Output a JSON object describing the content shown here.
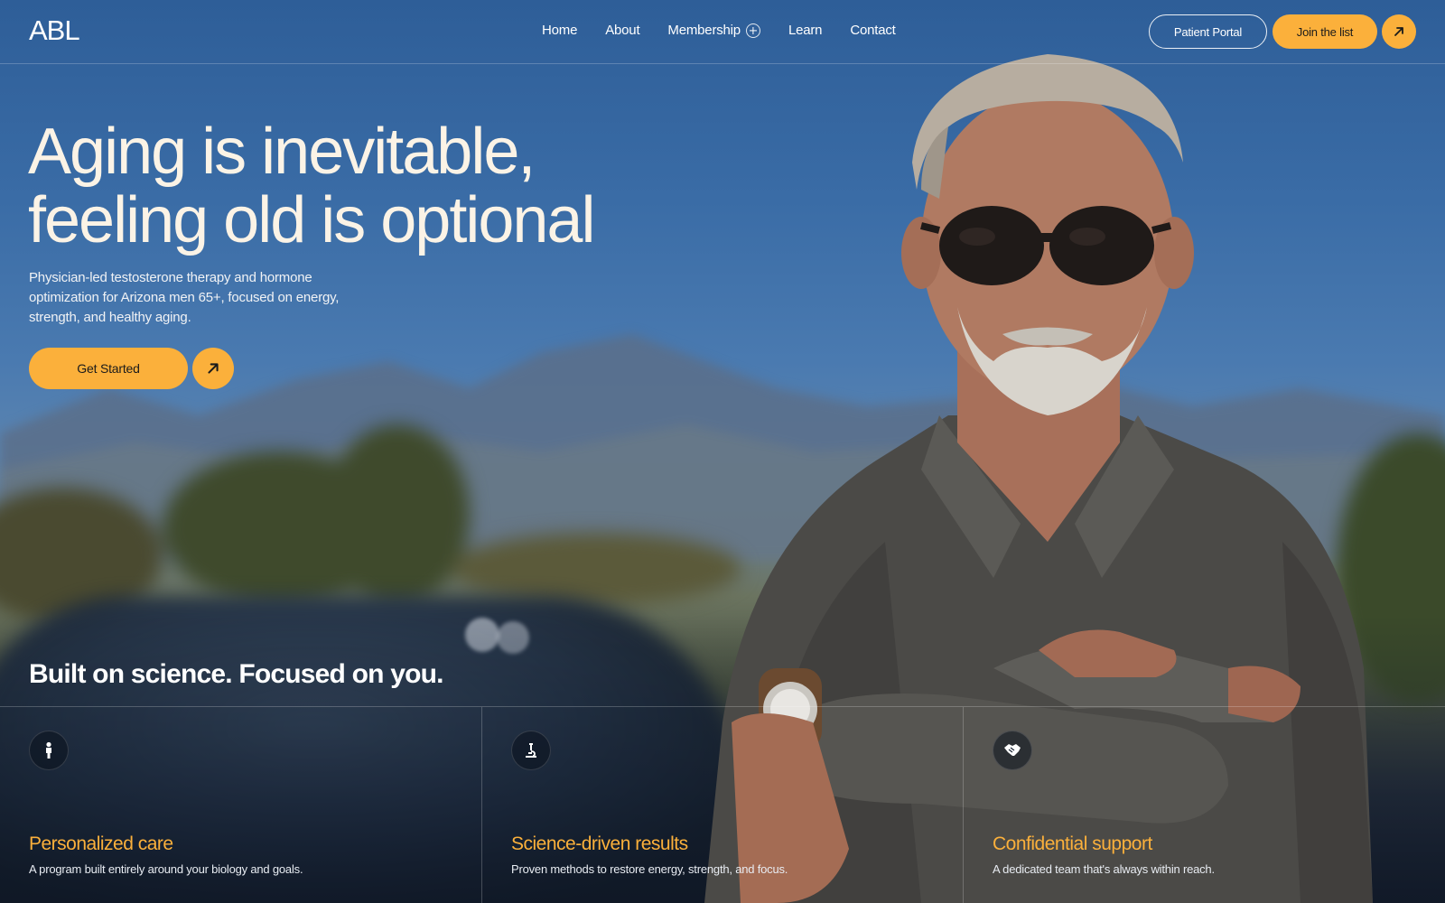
{
  "brand": {
    "logo_text": "ABL"
  },
  "nav": {
    "links": [
      {
        "label": "Home"
      },
      {
        "label": "About"
      },
      {
        "label": "Membership"
      },
      {
        "label": "Learn"
      },
      {
        "label": "Contact"
      }
    ],
    "portal_label": "Patient Portal",
    "join_label": "Join the list"
  },
  "hero": {
    "headline_line1": "Aging is inevitable,",
    "headline_line2": "feeling old is optional",
    "subtext": "Physician-led testosterone therapy and hormone optimization for Arizona men 65+, focused on energy, strength, and healthy aging.",
    "cta_label": "Get Started"
  },
  "features_section": {
    "tagline": "Built on science.  Focused on you.",
    "items": [
      {
        "icon": "person-icon",
        "title": "Personalized care",
        "description": "A program built entirely around your biology and goals."
      },
      {
        "icon": "microscope-icon",
        "title": "Science-driven results",
        "description": "Proven methods to restore energy, strength, and focus."
      },
      {
        "icon": "handshake-icon",
        "title": "Confidential support",
        "description": "A dedicated team that's always within reach."
      }
    ]
  },
  "colors": {
    "accent": "#fbb03b",
    "headline": "#fbf3e6",
    "sky": "#2e5e98"
  }
}
